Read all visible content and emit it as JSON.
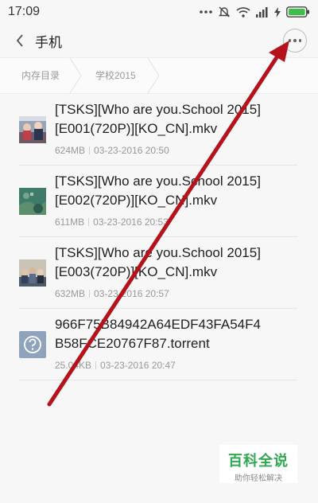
{
  "status_bar": {
    "time": "17:09"
  },
  "header": {
    "title": "手机"
  },
  "breadcrumb": [
    "内存目录",
    "学校2015"
  ],
  "files": [
    {
      "name": "[TSKS][Who are you.School 2015]\n[E001(720P)][KO_CN].mkv",
      "size": "624MB",
      "date": "03-23-2016 20:50",
      "thumb": "video-thumb"
    },
    {
      "name": "[TSKS][Who are you.School 2015]\n[E002(720P)][KO_CN].mkv",
      "size": "611MB",
      "date": "03-23-2016 20:53",
      "thumb": "video-thumb"
    },
    {
      "name": "[TSKS][Who are you.School 2015]\n[E003(720P)][KO_CN].mkv",
      "size": "632MB",
      "date": "03-23-2016 20:57",
      "thumb": "video-thumb"
    },
    {
      "name": "966F75B84942A64EDF43FA54F4\nB58FCE20767F87.torrent",
      "size": "25.04KB",
      "date": "03-23-2016 20:47",
      "thumb": "unknown-file-icon"
    }
  ],
  "watermark": {
    "main": "百科全说",
    "sub": "助你轻松解决"
  },
  "colors": {
    "annotation_arrow": "#b5121b",
    "watermark_green": "#2fa84f",
    "battery_green": "#3cc046"
  }
}
